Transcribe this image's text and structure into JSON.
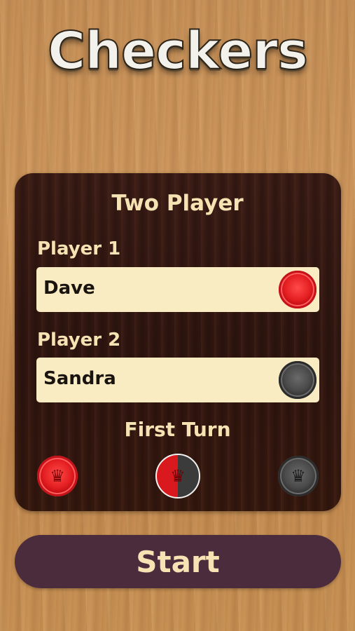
{
  "app": {
    "title": "Checkers"
  },
  "setup": {
    "mode_title": "Two Player",
    "player1": {
      "label": "Player 1",
      "name": "Dave",
      "piece_color": "red"
    },
    "player2": {
      "label": "Player 2",
      "name": "Sandra",
      "piece_color": "black"
    },
    "first_turn": {
      "label": "First Turn",
      "options": [
        "red",
        "random",
        "black"
      ],
      "selected": "random"
    },
    "start_label": "Start"
  },
  "colors": {
    "panel": "#2f1611",
    "text_cream": "#f6e3b4",
    "field_bg": "#faecc2",
    "button_bg": "#4b2c3d",
    "red_piece": "#e41f22",
    "black_piece": "#3b3b3b"
  },
  "icons": {
    "crown": "crown-icon"
  }
}
